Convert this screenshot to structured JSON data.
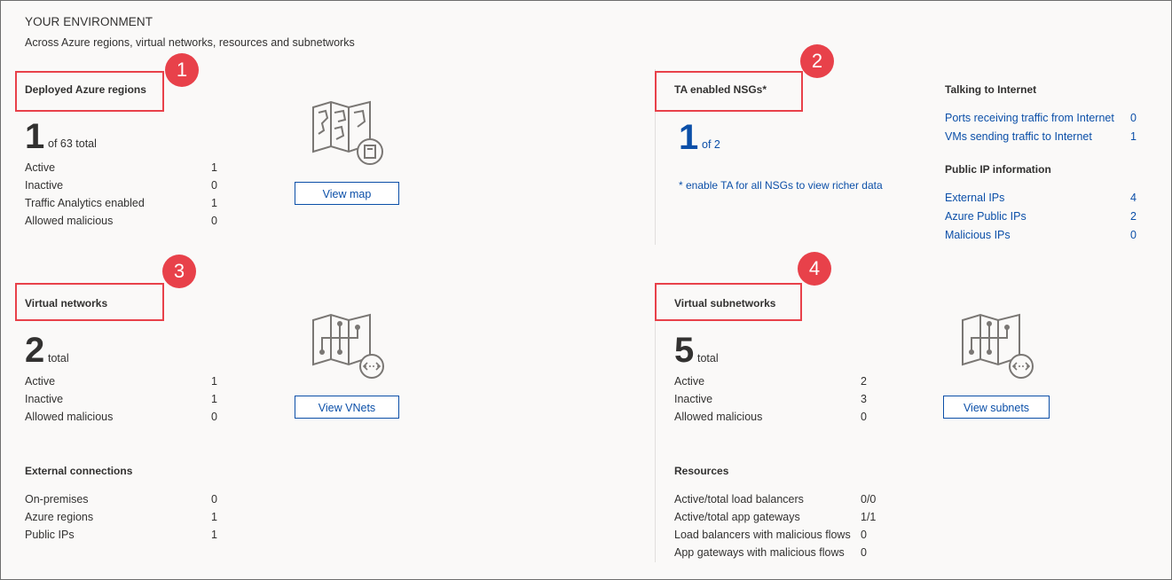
{
  "header": {
    "title": "YOUR ENVIRONMENT",
    "subtitle": "Across Azure regions, virtual networks, resources and subnetworks"
  },
  "regions": {
    "title": "Deployed Azure regions",
    "badge": "1",
    "count": "1",
    "count_suffix": "of 63 total",
    "rows": [
      {
        "label": "Active",
        "value": "1"
      },
      {
        "label": "Inactive",
        "value": "0"
      },
      {
        "label": "Traffic Analytics enabled",
        "value": "1"
      },
      {
        "label": "Allowed malicious",
        "value": "0"
      }
    ],
    "button": "View map",
    "icon": "map-icon"
  },
  "nsg": {
    "title": "TA enabled NSGs*",
    "badge": "2",
    "count": "1",
    "count_suffix": "of 2",
    "note": "* enable TA for all NSGs to view richer data"
  },
  "internet": {
    "title": "Talking to Internet",
    "rows": [
      {
        "label": "Ports receiving traffic from Internet",
        "value": "0"
      },
      {
        "label": "VMs sending traffic to Internet",
        "value": "1"
      }
    ],
    "public_ip_title": "Public IP information",
    "ip_rows": [
      {
        "label": "External IPs",
        "value": "4"
      },
      {
        "label": "Azure Public IPs",
        "value": "2"
      },
      {
        "label": "Malicious IPs",
        "value": "0"
      }
    ]
  },
  "vnets": {
    "title": "Virtual networks",
    "badge": "3",
    "count": "2",
    "count_suffix": "total",
    "rows": [
      {
        "label": "Active",
        "value": "1"
      },
      {
        "label": "Inactive",
        "value": "1"
      },
      {
        "label": "Allowed malicious",
        "value": "0"
      }
    ],
    "button": "View VNets",
    "icon": "network-map-icon"
  },
  "external": {
    "title": "External connections",
    "rows": [
      {
        "label": "On-premises",
        "value": "0"
      },
      {
        "label": "Azure regions",
        "value": "1"
      },
      {
        "label": "Public IPs",
        "value": "1"
      }
    ]
  },
  "subnets": {
    "title": "Virtual subnetworks",
    "badge": "4",
    "count": "5",
    "count_suffix": "total",
    "rows": [
      {
        "label": "Active",
        "value": "2"
      },
      {
        "label": "Inactive",
        "value": "3"
      },
      {
        "label": "Allowed malicious",
        "value": "0"
      }
    ],
    "button": "View subnets",
    "icon": "subnet-map-icon"
  },
  "resources": {
    "title": "Resources",
    "rows": [
      {
        "label": "Active/total load balancers",
        "value": "0/0"
      },
      {
        "label": "Active/total app gateways",
        "value": "1/1"
      },
      {
        "label": "Load balancers with malicious flows",
        "value": "0"
      },
      {
        "label": "App gateways with malicious flows",
        "value": "0"
      }
    ]
  },
  "colors": {
    "accent": "#0b4fa8",
    "annotation": "#e8414a"
  }
}
